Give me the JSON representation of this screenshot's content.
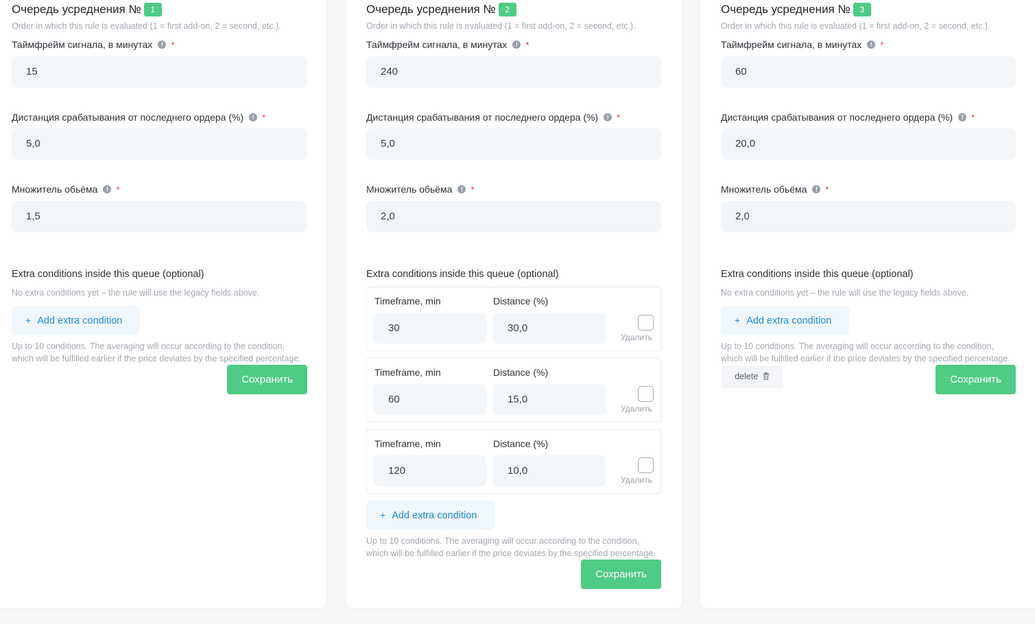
{
  "queues": [
    {
      "title": "Очередь усреднения №",
      "number": "1",
      "subtitle": "Order in which this rule is evaluated (1 = first add-on, 2 = second, etc.).",
      "timeframe_label": "Таймфрейм сигнала, в минутах",
      "timeframe_value": "15",
      "distance_label": "Дистанция срабатывания от последнего ордера (%)",
      "distance_value": "5,0",
      "multiplier_label": "Множитель обьёма",
      "multiplier_value": "1,5",
      "extra_title": "Extra conditions inside this queue (optional)",
      "no_extra_text": "No extra conditions yet – the rule will use the legacy fields above.",
      "add_label": "Add extra condition",
      "hint_line1": "Up to 10 conditions. The averaging will occur according to the condition,",
      "hint_line2": "which will be fulfilled earlier if the price deviates by the specified percentage.",
      "save_label": "Сохранить"
    },
    {
      "title": "Очередь усреднения №",
      "number": "2",
      "subtitle": "Order in which this rule is evaluated (1 = first add-on, 2 = second, etc.).",
      "timeframe_label": "Таймфрейм сигнала, в минутах",
      "timeframe_value": "240",
      "distance_label": "Дистанция срабатывания от последнего ордера (%)",
      "distance_value": "5,0",
      "multiplier_label": "Множитель обьёма",
      "multiplier_value": "2,0",
      "extra_title": "Extra conditions inside this queue (optional)",
      "conditions": [
        {
          "tf_label": "Timeframe, min",
          "tf_value": "30",
          "dist_label": "Distance (%)",
          "dist_value": "30,0",
          "delete_label": "Удалить"
        },
        {
          "tf_label": "Timeframe, min",
          "tf_value": "60",
          "dist_label": "Distance (%)",
          "dist_value": "15,0",
          "delete_label": "Удалить"
        },
        {
          "tf_label": "Timeframe, min",
          "tf_value": "120",
          "dist_label": "Distance (%)",
          "dist_value": "10,0",
          "delete_label": "Удалить"
        }
      ],
      "add_label": "Add extra condition",
      "hint_line1": "Up to 10 conditions. The averaging will occur according to the condition,",
      "hint_line2": "which will be fulfilled earlier if the price deviates by the specified percentage.",
      "save_label": "Сохранить"
    },
    {
      "title": "Очередь усреднения №",
      "number": "3",
      "subtitle": "Order in which this rule is evaluated (1 = first add-on, 2 = second, etc.).",
      "timeframe_label": "Таймфрейм сигнала, в минутах",
      "timeframe_value": "60",
      "distance_label": "Дистанция срабатывания от последнего ордера (%)",
      "distance_value": "20,0",
      "multiplier_label": "Множитель обьёма",
      "multiplier_value": "2,0",
      "extra_title": "Extra conditions inside this queue (optional)",
      "no_extra_text": "No extra conditions yet – the rule will use the legacy fields above.",
      "add_label": "Add extra condition",
      "hint_line1": "Up to 10 conditions. The averaging will occur according to the condition,",
      "hint_line2": "which will be fulfilled earlier if the price deviates by the specified percentage.",
      "delete_label": "delete",
      "save_label": "Сохранить"
    }
  ],
  "colors": {
    "accent_green": "#4ecb84",
    "link_blue": "#1e8ad2",
    "required_red": "#e5383b"
  }
}
